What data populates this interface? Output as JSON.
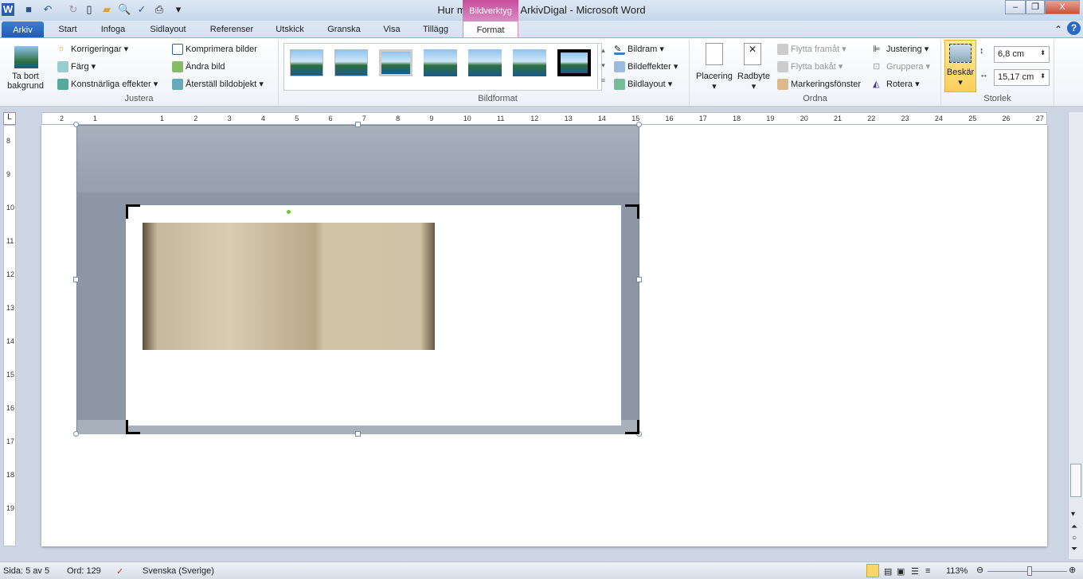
{
  "window": {
    "title": "Hur man arbetar i ArkivDigal  -  Microsoft Word",
    "context_tab": "Bildverktyg"
  },
  "tabs": [
    "Arkiv",
    "Start",
    "Infoga",
    "Sidlayout",
    "Referenser",
    "Utskick",
    "Granska",
    "Visa",
    "Tillägg",
    "Format"
  ],
  "ribbon": {
    "justera": {
      "label": "Justera",
      "remove_bg": "Ta bort bakgrund",
      "corrections": "Korrigeringar",
      "color": "Färg",
      "artistic": "Konstnärliga effekter",
      "compress": "Komprimera bilder",
      "change": "Ändra bild",
      "reset": "Återställ bildobjekt"
    },
    "bildformat": {
      "label": "Bildformat",
      "frame": "Bildram",
      "effects": "Bildeffekter",
      "layout": "Bildlayout"
    },
    "ordna": {
      "label": "Ordna",
      "position": "Placering",
      "wrap": "Radbyte",
      "forward": "Flytta framåt",
      "backward": "Flytta bakåt",
      "pane": "Markeringsfönster",
      "align": "Justering",
      "group": "Gruppera",
      "rotate": "Rotera"
    },
    "storlek": {
      "label": "Storlek",
      "crop": "Beskär",
      "height": "6,8 cm",
      "width": "15,17 cm"
    }
  },
  "ruler": {
    "h": [
      "2",
      "1",
      "1",
      "2",
      "3",
      "4",
      "5",
      "6",
      "7",
      "8",
      "9",
      "10",
      "11",
      "12",
      "13",
      "14",
      "15",
      "16",
      "17",
      "18",
      "19",
      "20",
      "21",
      "22",
      "23",
      "24",
      "25",
      "26",
      "27"
    ],
    "v": [
      "8",
      "9",
      "10",
      "11",
      "12",
      "13",
      "14",
      "15",
      "16",
      "17",
      "18",
      "19"
    ]
  },
  "status": {
    "page": "Sida: 5 av 5",
    "words": "Ord: 129",
    "language": "Svenska (Sverige)",
    "zoom": "113%"
  },
  "colors": {
    "accent": "#c94d9c",
    "arkiv": "#2a6ac2"
  }
}
